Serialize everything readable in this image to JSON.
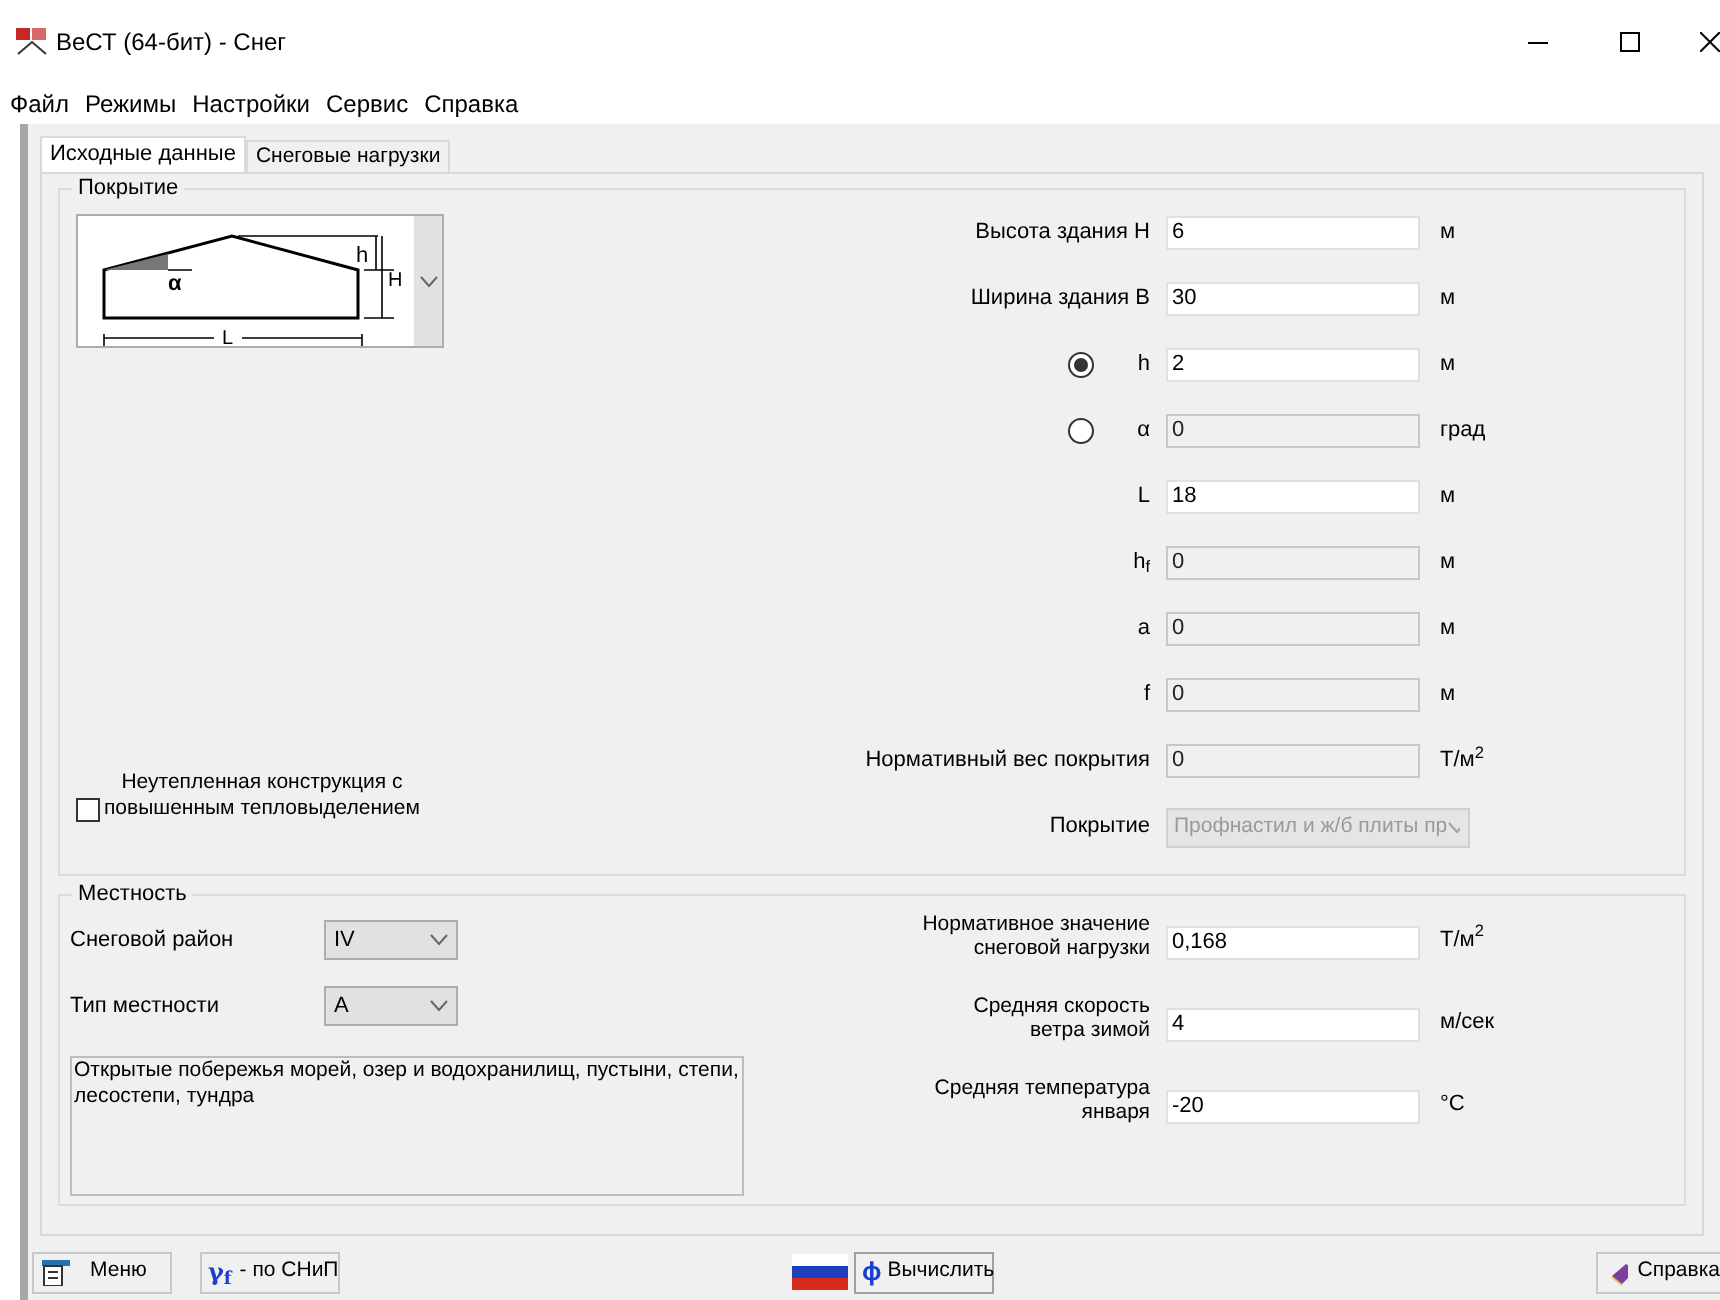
{
  "window": {
    "title": "ВеСТ (64-бит) - Снег"
  },
  "menu": [
    "Файл",
    "Режимы",
    "Настройки",
    "Сервис",
    "Справка"
  ],
  "tabs": [
    {
      "label": "Исходные данные",
      "selected": true
    },
    {
      "label": "Снеговые нагрузки",
      "selected": false
    }
  ],
  "covering": {
    "title": "Покрытие",
    "scheme_labels": {
      "alpha": "α",
      "h": "h",
      "H": "H",
      "L": "L"
    },
    "fields": [
      {
        "kind": "input",
        "label": "Высота здания Н",
        "value": "6",
        "unit": "м",
        "disabled": false
      },
      {
        "kind": "input",
        "label": "Ширина здания В",
        "value": "30",
        "unit": "м",
        "disabled": false
      },
      {
        "kind": "radio",
        "label": "h",
        "value": "2",
        "unit": "м",
        "disabled": false,
        "selected": true
      },
      {
        "kind": "radio",
        "label": "α",
        "value": "0",
        "unit": "град",
        "disabled": true,
        "selected": false
      },
      {
        "kind": "input",
        "label": "L",
        "value": "18",
        "unit": "м",
        "disabled": false
      },
      {
        "kind": "input",
        "label": "h$_{f}$",
        "value": "0",
        "unit": "м",
        "disabled": true
      },
      {
        "kind": "input",
        "label": "a",
        "value": "0",
        "unit": "м",
        "disabled": true
      },
      {
        "kind": "input",
        "label": "f",
        "value": "0",
        "unit": "м",
        "disabled": true
      },
      {
        "kind": "input",
        "label": "Нормативный вес покрытия",
        "value": "0",
        "unit": "Т/м$^{2}$",
        "disabled": true
      },
      {
        "kind": "select",
        "label": "Покрытие",
        "value": "Профнастил и ж/б плиты пр",
        "disabled": true
      }
    ],
    "checkbox": {
      "label": "Неутепленная конструкция с\nповышенным тепловыделением",
      "checked": false
    }
  },
  "terrain": {
    "title": "Местность",
    "selects": [
      {
        "label": "Снеговой район",
        "value": "IV"
      },
      {
        "label": "Тип местности",
        "value": "A"
      }
    ],
    "description": "Открытые побережья морей, озер и водохранилищ, пустыни, степи, лесостепи, тундра",
    "fields": [
      {
        "label": "Нормативное значение\nснеговой нагрузки",
        "value": "0,168",
        "unit": "Т/м$^{2}$"
      },
      {
        "label": "Средняя скорость\nветра зимой",
        "value": "4",
        "unit": "м/сек"
      },
      {
        "label": "Средняя температура\nянваря",
        "value": "-20",
        "unit": "°С"
      }
    ]
  },
  "toolbar": {
    "menu_button": "Меню",
    "norm_button": {
      "symbol": "γ$_{f}$",
      "label": "- по СНиП"
    },
    "calc_button": {
      "symbol": "ϕ",
      "label": "Вычислить"
    },
    "help_button": "Справка"
  }
}
